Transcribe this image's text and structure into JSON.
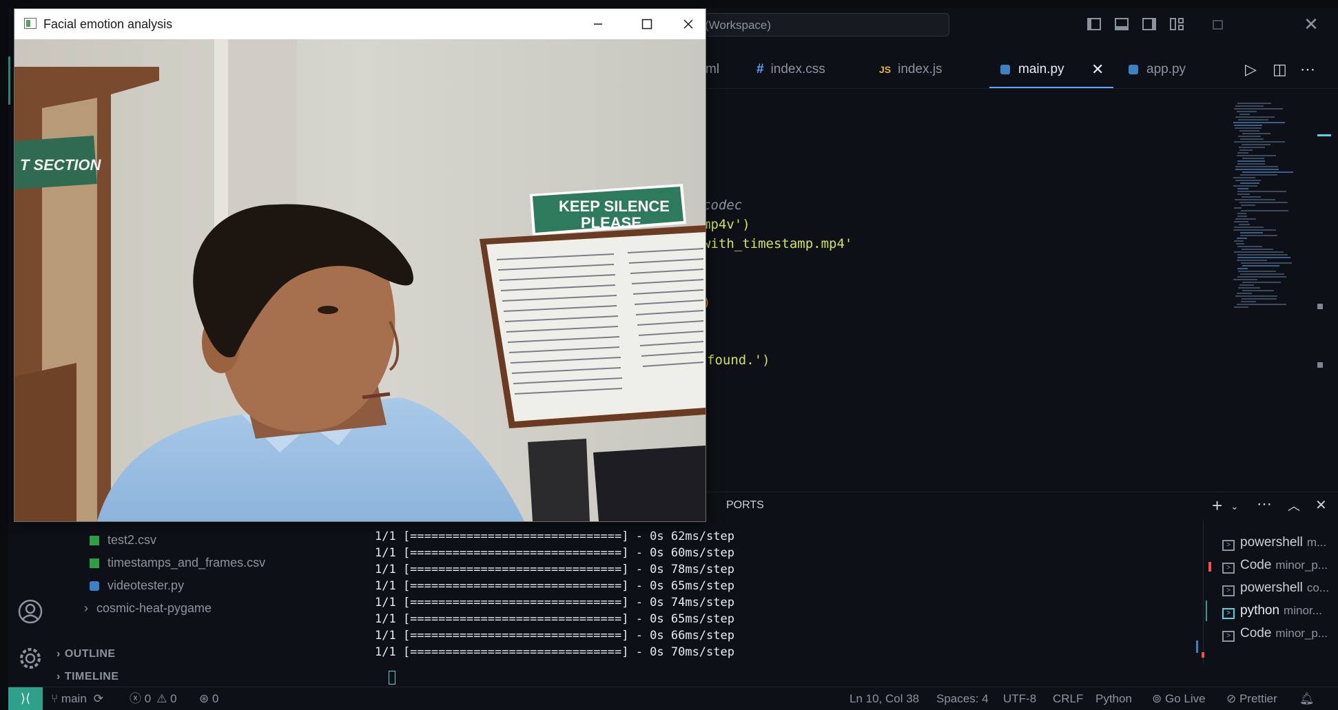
{
  "vscode": {
    "command_center": "Workspace)",
    "tabs": [
      {
        "label": "ml",
        "icon": ""
      },
      {
        "label": "index.css",
        "icon": "#"
      },
      {
        "label": "index.js",
        "icon": "JS"
      },
      {
        "label": "main.py",
        "icon": "python-icon",
        "active": true
      },
      {
        "label": "app.py",
        "icon": "python-icon"
      }
    ],
    "code_lines": [
      {
        "text": "codec",
        "color": "#8b949e",
        "italic": true
      },
      {
        "text": "mp4v')",
        "color": "#d4e157"
      },
      {
        "text": "with_timestamp.mp4'",
        "color": "#d4e157"
      },
      {
        "text": ")",
        "color": "#d29922"
      },
      {
        "text": "found.')",
        "color": "#d4e157"
      }
    ],
    "sidebar": {
      "files": [
        {
          "name": "test2.csv",
          "type": "csv"
        },
        {
          "name": "timestamps_and_frames.csv",
          "type": "csv"
        },
        {
          "name": "videotester.py",
          "type": "py"
        },
        {
          "name": "cosmic-heat-pygame",
          "type": "folder"
        }
      ],
      "outline": "OUTLINE",
      "timeline": "TIMELINE"
    },
    "panel": {
      "ports_tab": "PORTS",
      "terminal_lines": [
        "1/1 [==============================] - 0s 62ms/step",
        "1/1 [==============================] - 0s 60ms/step",
        "1/1 [==============================] - 0s 78ms/step",
        "1/1 [==============================] - 0s 65ms/step",
        "1/1 [==============================] - 0s 74ms/step",
        "1/1 [==============================] - 0s 65ms/step",
        "1/1 [==============================] - 0s 66ms/step",
        "1/1 [==============================] - 0s 70ms/step"
      ],
      "terminals": [
        {
          "name": "powershell",
          "sub": "m..."
        },
        {
          "name": "Code",
          "sub": "minor_p..."
        },
        {
          "name": "powershell",
          "sub": "co..."
        },
        {
          "name": "python",
          "sub": "minor...",
          "active": true
        },
        {
          "name": "Code",
          "sub": "minor_p..."
        }
      ]
    },
    "statusbar": {
      "branch": "main",
      "errors": "0",
      "warnings": "0",
      "ports": "0",
      "cursor": "Ln 10, Col 38",
      "spaces": "Spaces: 4",
      "encoding": "UTF-8",
      "eol": "CRLF",
      "language": "Python",
      "golive": "Go Live",
      "prettier": "Prettier"
    }
  },
  "camera_window": {
    "title": "Facial emotion analysis",
    "scene_text": {
      "section_sign": "T SECTION",
      "silence_sign_line1": "KEEP SILENCE",
      "silence_sign_line2": "PLEASE"
    }
  },
  "colors": {
    "accent": "#58a6ff",
    "remote": "#2ea08a",
    "editor_bg": "#0d1117"
  }
}
